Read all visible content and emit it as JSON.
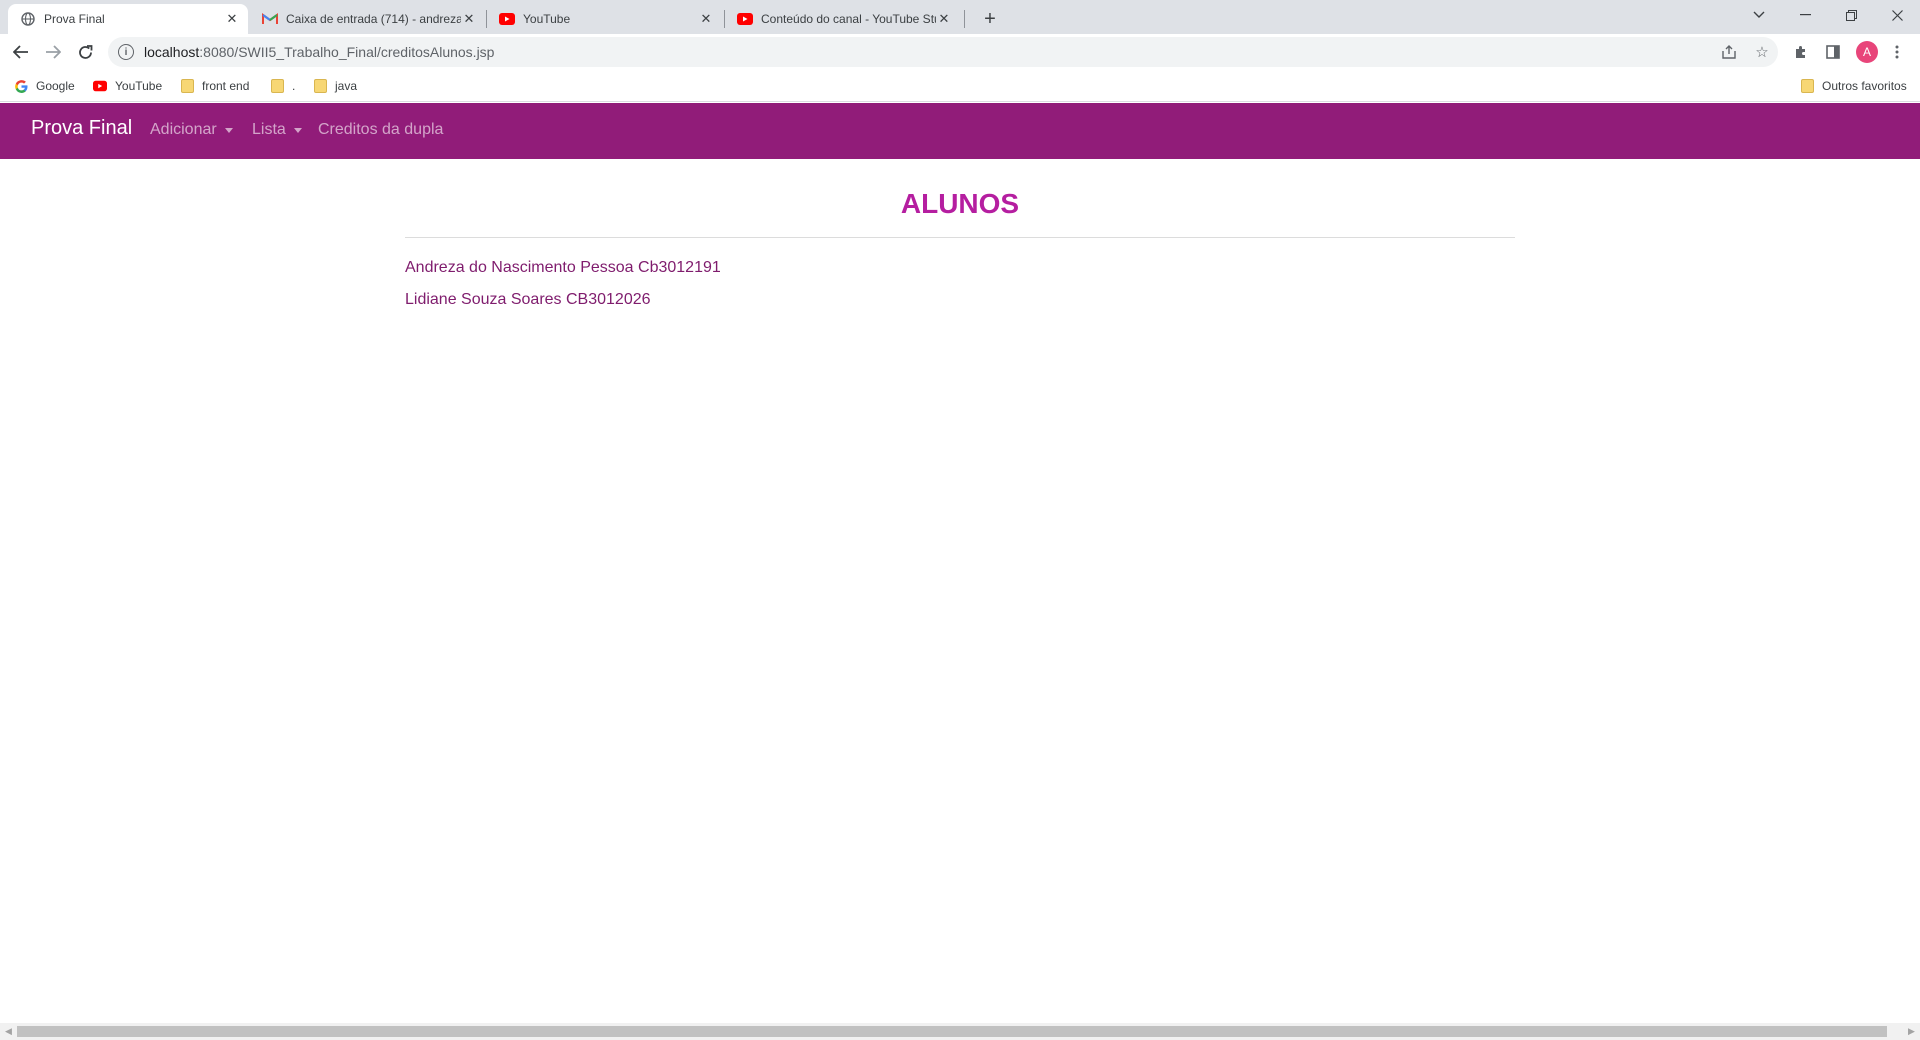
{
  "browser": {
    "tabs": [
      {
        "title": "Prova Final",
        "icon": "globe-icon",
        "active": true
      },
      {
        "title": "Caixa de entrada (714) - andreza",
        "icon": "gmail-icon",
        "active": false
      },
      {
        "title": "YouTube",
        "icon": "youtube-icon",
        "active": false
      },
      {
        "title": "Conteúdo do canal - YouTube Stu",
        "icon": "youtube-studio-icon",
        "active": false
      }
    ],
    "url_host": "localhost",
    "url_path": ":8080/SWII5_Trabalho_Final/creditosAlunos.jsp",
    "profile_initial": "A",
    "bookmarks": [
      {
        "label": "Google",
        "icon": "google-icon"
      },
      {
        "label": "YouTube",
        "icon": "youtube-icon"
      },
      {
        "label": "front end",
        "icon": "folder-icon"
      },
      {
        "label": ".",
        "icon": "folder-icon"
      },
      {
        "label": "java",
        "icon": "folder-icon"
      }
    ],
    "other_bookmarks": "Outros favoritos"
  },
  "app": {
    "brand": "Prova Final",
    "nav": [
      {
        "label": "Adicionar",
        "dropdown": true
      },
      {
        "label": "Lista",
        "dropdown": true
      },
      {
        "label": "Creditos da dupla",
        "dropdown": false
      }
    ],
    "accent_color": "#911c79"
  },
  "page": {
    "title": "ALUNOS",
    "students": [
      "Andreza do Nascimento Pessoa Cb3012191",
      "Lidiane Souza Soares CB3012026"
    ]
  }
}
